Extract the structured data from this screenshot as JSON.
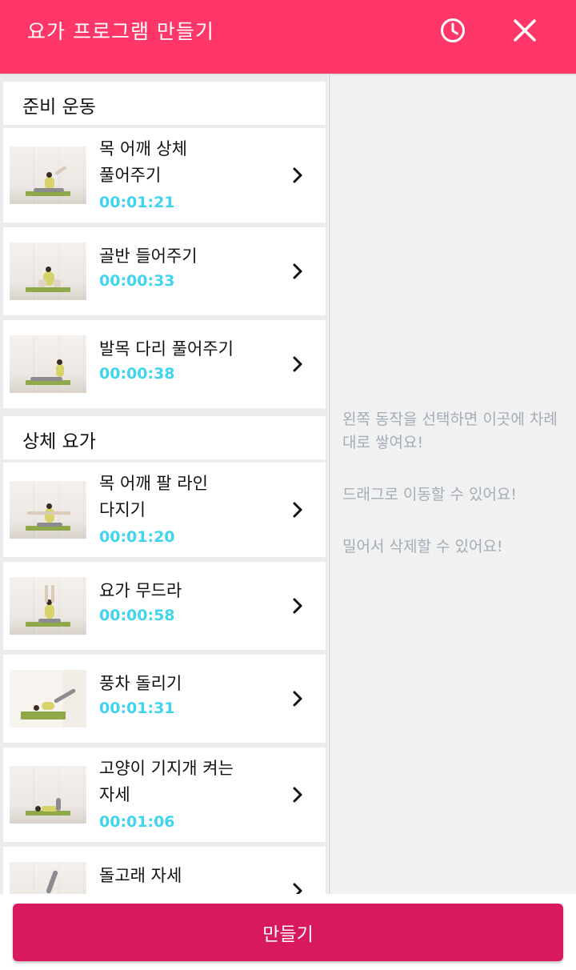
{
  "header": {
    "title": "요가 프로그램 만들기",
    "history_icon": "clock-icon",
    "close_icon": "close-icon",
    "bg_color": "#ff3668"
  },
  "sections": [
    {
      "label": "준비 운동",
      "items": [
        {
          "name": "목 어깨 상체\n풀어주기",
          "time": "00:01:21"
        },
        {
          "name": "골반 들어주기",
          "time": "00:00:33"
        },
        {
          "name": "발목 다리 풀어주기",
          "time": "00:00:38"
        }
      ]
    },
    {
      "label": "상체 요가",
      "items": [
        {
          "name": "목 어깨 팔 라인\n다지기",
          "time": "00:01:20"
        },
        {
          "name": "요가 무드라",
          "time": "00:00:58"
        },
        {
          "name": "풍차 돌리기",
          "time": "00:01:31"
        },
        {
          "name": "고양이 기지개 켜는\n자세",
          "time": "00:01:06"
        },
        {
          "name": "돌고래 자세",
          "time": ""
        }
      ]
    }
  ],
  "hints": [
    "왼쪽 동작을 선택하면 이곳에 차례대로 쌓여요!",
    "드래그로 이동할 수 있어요!",
    "밀어서 삭제할 수 있어요!"
  ],
  "footer": {
    "make_label": "만들기",
    "button_color": "#d9195d"
  },
  "time_color": "#40d4ee"
}
